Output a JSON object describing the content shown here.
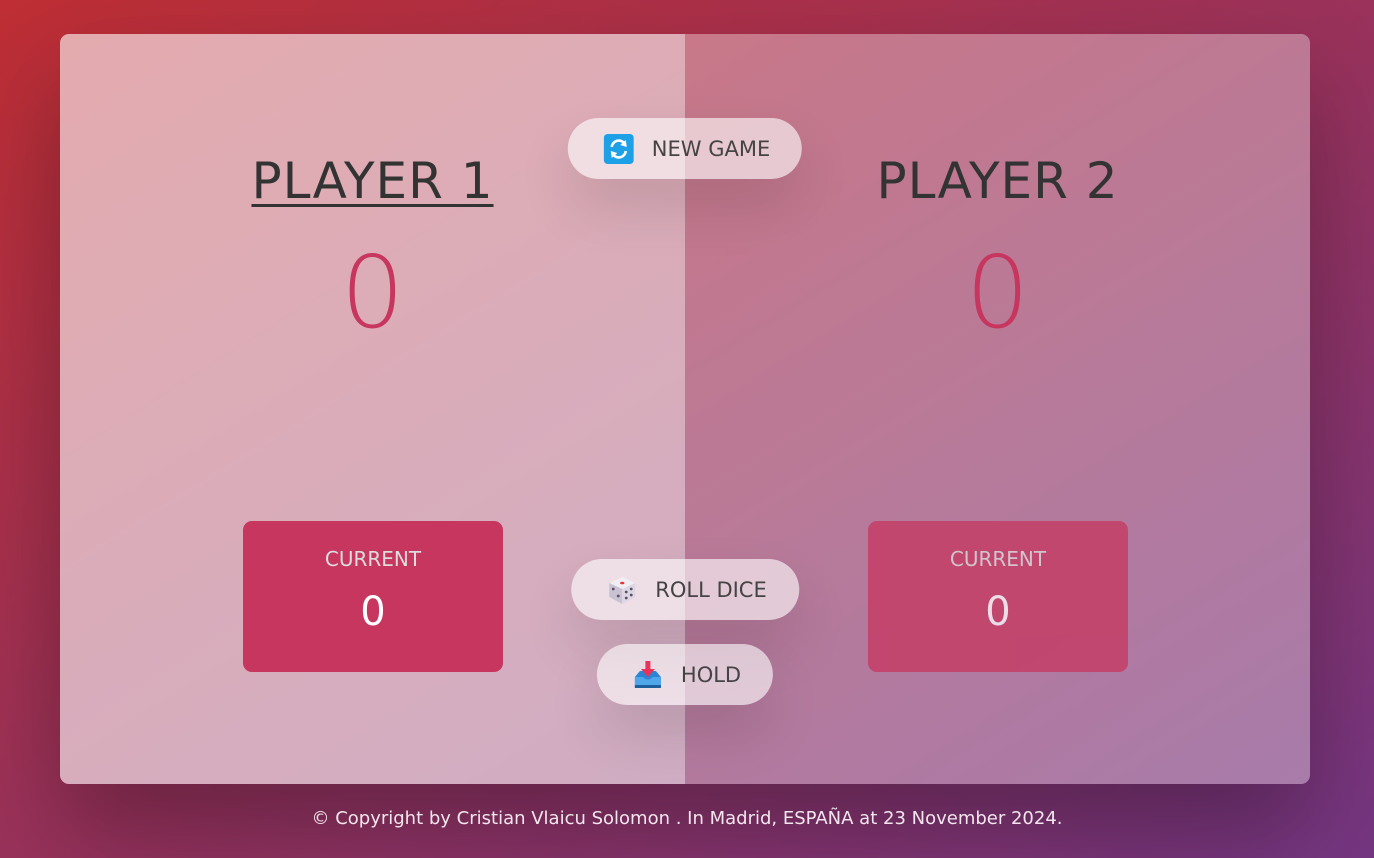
{
  "players": [
    {
      "name": "PLAYER 1",
      "score": "0",
      "current_label": "CURRENT",
      "current_score": "0",
      "active": true
    },
    {
      "name": "PLAYER 2",
      "score": "0",
      "current_label": "CURRENT",
      "current_score": "0",
      "active": false
    }
  ],
  "buttons": {
    "new_game": {
      "label": "NEW GAME",
      "icon": "refresh-icon"
    },
    "roll_dice": {
      "label": "ROLL DICE",
      "icon": "dice-icon"
    },
    "hold": {
      "label": "HOLD",
      "icon": "inbox-tray-icon"
    }
  },
  "footer": {
    "text": "© Copyright by Cristian Vlaicu Solomon . In Madrid, ESPAÑA at 23 November 2024."
  },
  "colors": {
    "accent": "#c7365f",
    "background_from": "#bf2e34",
    "background_to": "#753682"
  }
}
